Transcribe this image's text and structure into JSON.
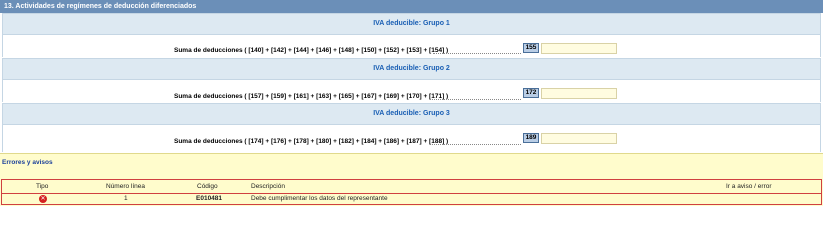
{
  "section": {
    "title": "13. Actividades de regímenes de deducción diferenciados"
  },
  "groups": [
    {
      "title": "IVA deducible: Grupo 1",
      "sum_label": "Suma de deducciones ( [140] + [142] + [144] + [146] + [148] + [150] + [152] + [153] + [154] )",
      "box": "155",
      "value": ""
    },
    {
      "title": "IVA deducible: Grupo 2",
      "sum_label": "Suma de deducciones ( [157] + [159] + [161] + [163] + [165] + [167] + [169] + [170] + [171] )",
      "box": "172",
      "value": ""
    },
    {
      "title": "IVA deducible: Grupo 3",
      "sum_label": "Suma de deducciones ( [174] + [176] + [178] + [180] + [182] + [184] + [186] + [187] + [188] )",
      "box": "189",
      "value": ""
    }
  ],
  "errors": {
    "title": "Errores y avisos",
    "columns": {
      "tipo": "Tipo",
      "linea": "Número línea",
      "codigo": "Código",
      "descripcion": "Descripción",
      "ir": "Ir a aviso / error"
    },
    "rows": [
      {
        "icon": "error-icon",
        "icon_glyph": "✕",
        "linea": "1",
        "codigo": "E010481",
        "descripcion": "Debe cumplimentar los datos del representante"
      }
    ]
  },
  "colors": {
    "header": "#6b8fb8",
    "group_bar": "#dde9f2",
    "group_title": "#1a5fb4",
    "box_num": "#b9cde5",
    "input": "#fffce0",
    "errors_bg": "#fffccc",
    "error_border": "#d04040"
  }
}
